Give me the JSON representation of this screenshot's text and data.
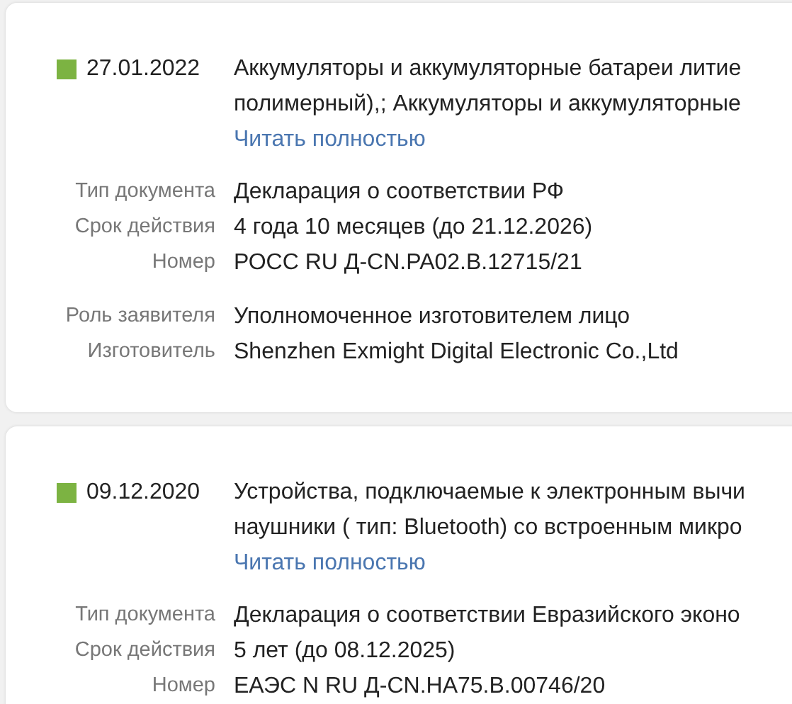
{
  "documents": [
    {
      "color": "#7cb342",
      "date": "27.01.2022",
      "description_lines": [
        "Аккумуляторы и аккумуляторные батареи литие",
        "полимерный),; Аккумуляторы и аккумуляторные"
      ],
      "link": "Читать полностью",
      "field_groups": [
        [
          {
            "label": "Тип документа",
            "value": "Декларация о соответствии РФ"
          },
          {
            "label": "Срок действия",
            "value": "4 года 10 месяцев (до 21.12.2026)"
          },
          {
            "label": "Номер",
            "value": "РОСС RU Д-CN.PA02.B.12715/21"
          }
        ],
        [
          {
            "label": "Роль заявителя",
            "value": "Уполномоченное изготовителем лицо"
          },
          {
            "label": "Изготовитель",
            "value": "Shenzhen Exmight Digital Electronic Co.,Ltd"
          }
        ]
      ]
    },
    {
      "color": "#7cb342",
      "date": "09.12.2020",
      "description_lines": [
        "Устройства, подключаемые к электронным вычи",
        "наушники ( тип: Bluetooth) со встроенным микро"
      ],
      "link": "Читать полностью",
      "field_groups": [
        [
          {
            "label": "Тип документа",
            "value": "Декларация о соответствии Евразийского эконо"
          },
          {
            "label": "Срок действия",
            "value": "5 лет (до 08.12.2025)"
          },
          {
            "label": "Номер",
            "value": "ЕАЭС N RU Д-CN.HA75.B.00746/20"
          }
        ]
      ]
    }
  ]
}
